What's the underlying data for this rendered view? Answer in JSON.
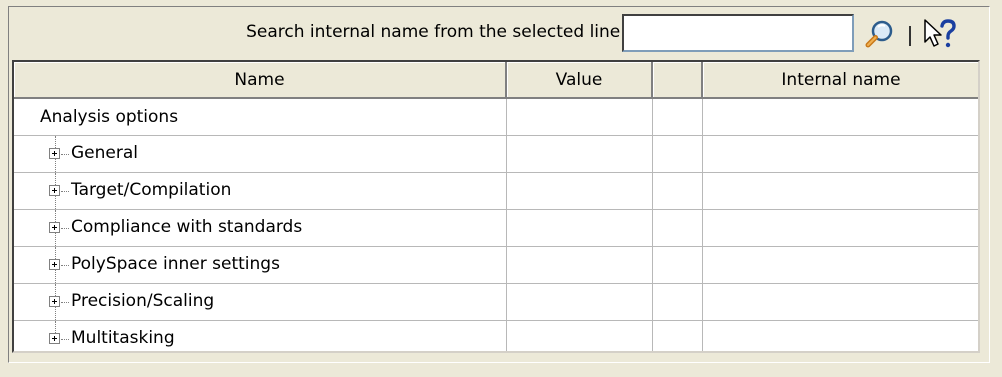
{
  "search": {
    "label": "Search internal name from the selected line:",
    "value": "",
    "placeholder": ""
  },
  "toolbar": {
    "search_icon": "magnifier-icon",
    "help_icon": "context-help-icon"
  },
  "table": {
    "columns": [
      "Name",
      "Value",
      "",
      "Internal name"
    ],
    "root": {
      "label": "Analysis options"
    },
    "nodes": [
      {
        "label": "General"
      },
      {
        "label": "Target/Compilation"
      },
      {
        "label": "Compliance with standards"
      },
      {
        "label": "PolySpace inner settings"
      },
      {
        "label": "Precision/Scaling"
      },
      {
        "label": "Multitasking"
      }
    ]
  }
}
